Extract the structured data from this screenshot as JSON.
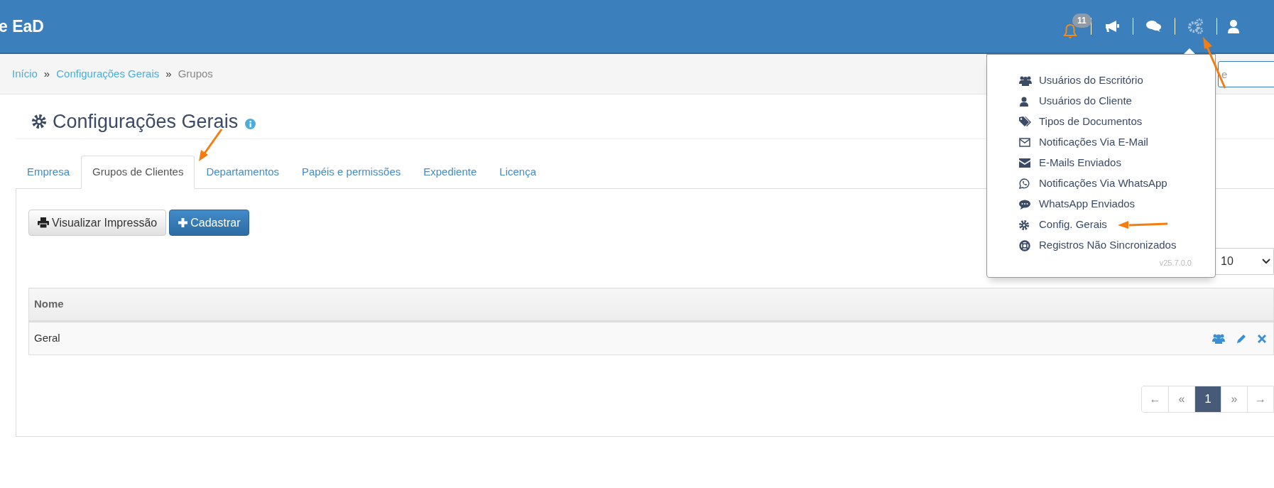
{
  "header": {
    "brand": "e EaD",
    "notifications": {
      "count": "11"
    }
  },
  "breadcrumb": [
    {
      "label": "Início",
      "link": true
    },
    {
      "label": "Configurações Gerais",
      "link": true
    },
    {
      "label": "Grupos",
      "link": false
    }
  ],
  "breadcrumb_separator": "»",
  "search": {
    "placeholder": "e"
  },
  "page_title": "Configurações Gerais",
  "tabs": [
    {
      "label": "Empresa",
      "selected": false
    },
    {
      "label": "Grupos de Clientes",
      "selected": true
    },
    {
      "label": "Departamentos",
      "selected": false
    },
    {
      "label": "Papéis e permissões",
      "selected": false
    },
    {
      "label": "Expediente",
      "selected": false
    },
    {
      "label": "Licença",
      "selected": false
    }
  ],
  "toolbar": [
    {
      "label": "Visualizar Impressão",
      "kind": "print"
    },
    {
      "label": "Cadastrar",
      "kind": "add"
    }
  ],
  "page_size": "10",
  "table": {
    "columns": [
      "Nome"
    ],
    "rows": [
      {
        "name": "Geral"
      }
    ]
  },
  "pagination": [
    {
      "label": "←",
      "selected": false
    },
    {
      "label": "«",
      "selected": false
    },
    {
      "label": "1",
      "selected": true
    },
    {
      "label": "»",
      "selected": false
    },
    {
      "label": "→",
      "selected": false
    }
  ],
  "settings_menu": {
    "items": [
      {
        "label": "Usuários do Escritório",
        "kind": "users"
      },
      {
        "label": "Usuários do Cliente",
        "kind": "user"
      },
      {
        "label": "Tipos de Documentos",
        "kind": "tags"
      },
      {
        "label": "Notificações Via E-Mail",
        "kind": "mail"
      },
      {
        "label": "E-Mails Enviados",
        "kind": "envelope"
      },
      {
        "label": "Notificações Via WhatsApp",
        "kind": "whatsapp"
      },
      {
        "label": "WhatsApp Enviados",
        "kind": "chat"
      },
      {
        "label": "Config. Gerais",
        "kind": "gear"
      },
      {
        "label": "Registros Não Sincronizados",
        "kind": "lifebuoy"
      }
    ],
    "version": "v25.7.0.0"
  }
}
